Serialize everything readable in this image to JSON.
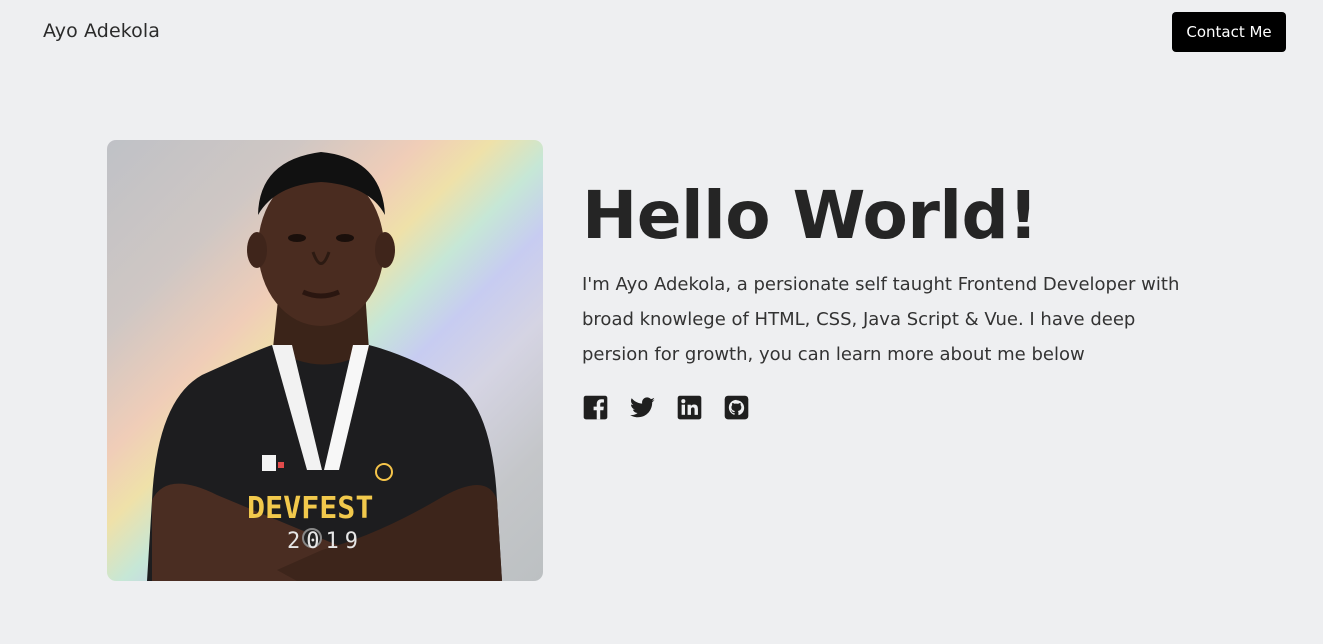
{
  "nav": {
    "brand": "Ayo Adekola",
    "contact_label": "Contact Me"
  },
  "hero": {
    "headline": "Hello World!",
    "bio": "I'm Ayo Adekola, a persionate self taught Frontend Developer with broad knowlege of HTML, CSS, Java Script & Vue. I have deep persion for growth, you can learn more about me below",
    "photo_icon": "portrait-photo",
    "shirt_text": "DEVFEST",
    "shirt_year": "2019"
  },
  "socials": [
    {
      "icon": "facebook-icon"
    },
    {
      "icon": "twitter-icon"
    },
    {
      "icon": "linkedin-icon"
    },
    {
      "icon": "github-icon"
    }
  ],
  "colors": {
    "background": "#eeeff1",
    "button_bg": "#000000",
    "button_text": "#ffffff",
    "text": "#252525"
  }
}
